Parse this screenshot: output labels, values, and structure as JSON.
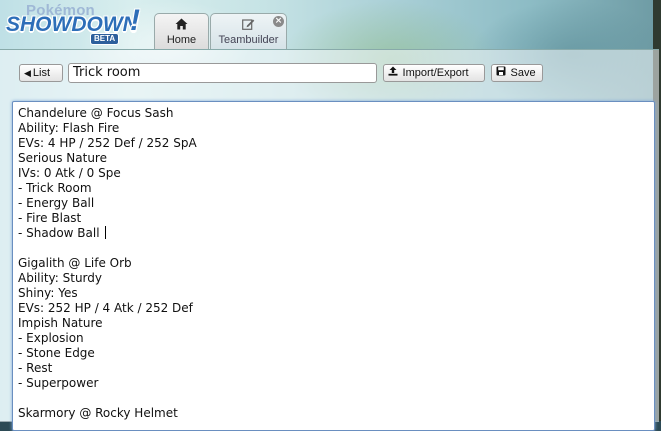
{
  "header": {
    "logo": {
      "pokemon": "Pokémon",
      "showdown": "SHOWDOWN",
      "bang": "!",
      "beta": "BETA"
    },
    "tabs": [
      {
        "label": "Home",
        "icon": "home-icon"
      },
      {
        "label": "Teambuilder",
        "icon": "edit-icon",
        "close": "×"
      }
    ]
  },
  "toolbar": {
    "list_label": "List",
    "team_name": "Trick room",
    "import_label": "Import/Export",
    "save_label": "Save"
  },
  "editor": {
    "lines": [
      "Chandelure @ Focus Sash",
      "Ability: Flash Fire",
      "EVs: 4 HP / 252 Def / 252 SpA",
      "Serious Nature",
      "IVs: 0 Atk / 0 Spe",
      "- Trick Room",
      "- Energy Ball",
      "- Fire Blast",
      "- Shadow Ball",
      "",
      "Gigalith @ Life Orb",
      "Ability: Sturdy",
      "Shiny: Yes",
      "EVs: 252 HP / 4 Atk / 252 Def",
      "Impish Nature",
      "- Explosion",
      "- Stone Edge",
      "- Rest",
      "- Superpower",
      "",
      "Skarmory @ Rocky Helmet"
    ]
  }
}
